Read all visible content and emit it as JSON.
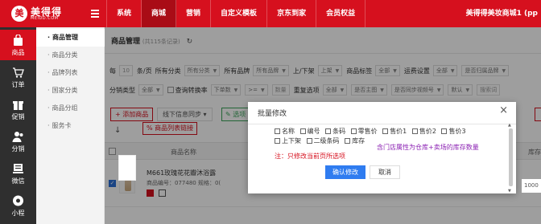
{
  "brand": {
    "badge": "美",
    "title": "美得得",
    "subtitle": "MEIDD.COM",
    "color": "#d6101e"
  },
  "topnav": [
    {
      "label": "系统"
    },
    {
      "label": "商城"
    },
    {
      "label": "营销"
    },
    {
      "label": "自定义模板"
    },
    {
      "label": "京东到家"
    },
    {
      "label": "会员权益"
    }
  ],
  "user": {
    "name": "美得得美妆商城1 (pp"
  },
  "sidebar": [
    {
      "label": "商品",
      "icon": "bag-icon"
    },
    {
      "label": "订单",
      "icon": "cart-icon"
    },
    {
      "label": "促销",
      "icon": "gift-icon"
    },
    {
      "label": "分销",
      "icon": "users-icon"
    },
    {
      "label": "微信",
      "icon": "wechat-icon"
    },
    {
      "label": "小程",
      "icon": "miniapp-icon"
    }
  ],
  "submenu": [
    {
      "label": "商品管理"
    },
    {
      "label": "商品分类"
    },
    {
      "label": "品牌列表"
    },
    {
      "label": "国家分类"
    },
    {
      "label": "商品分组"
    },
    {
      "label": "服务卡"
    }
  ],
  "page": {
    "title": "商品管理",
    "count": "(共115条记录)"
  },
  "filters": {
    "row1": {
      "per_page_label": "每",
      "per_page": "10",
      "unit": "条/页",
      "category_label": "所有分类",
      "category": "所有分类",
      "brand_label": "所有品牌",
      "brand": "所有品牌",
      "listing_label": "上/下架",
      "listing": "上架",
      "tag_label": "商品标签",
      "tag": "全部",
      "shipping_label": "运费设置",
      "shipping": "全部",
      "last": "是否归属品牌"
    },
    "row2": {
      "dist_label": "分销类型",
      "dist": "全部",
      "check_label": "查询转换率",
      "rate_op": "下单数",
      "compare": ">=",
      "qty_placeholder": "数量",
      "dup_label": "重复选项",
      "dup": "全部",
      "main_label": "是否主图",
      "sync_label": "是否同步视频号",
      "sort": "默认",
      "search_placeholder": "搜索词"
    }
  },
  "actions": {
    "add": "+ 添加商品",
    "sync": "线下信息同步",
    "green": "选项",
    "link": "商品列表链接"
  },
  "table": {
    "header_name": "商品名称",
    "header_stock": "库存",
    "row": {
      "name": "M661玫瑰花花瓣沐浴露",
      "meta": "商品编号：077480 规格：0(",
      "stock": "1000"
    }
  },
  "modal": {
    "title": "批量修改",
    "close": "×",
    "options": [
      "名称",
      "编号",
      "条码",
      "零售价",
      "售价1",
      "售价2",
      "售价3",
      "上下架",
      "二级条码",
      "库存"
    ],
    "note_left": "注：只修改当前页所选项",
    "note_right": "含门店属性为仓库+卖场的库存数量",
    "confirm": "确认修改",
    "cancel": "取消"
  }
}
